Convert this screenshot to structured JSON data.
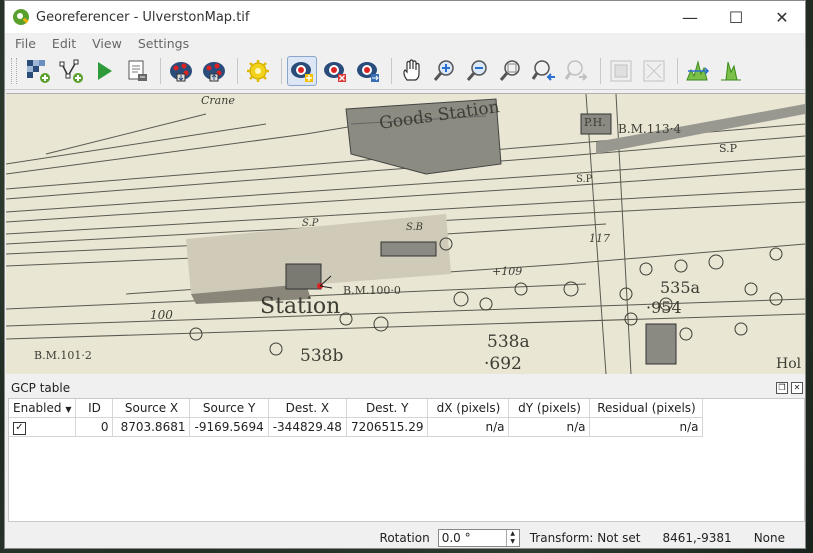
{
  "window": {
    "title": "Georeferencer - UlverstonMap.tif",
    "minimize": "—",
    "maximize": "☐",
    "close": "✕"
  },
  "menu": [
    "File",
    "Edit",
    "View",
    "Settings"
  ],
  "map": {
    "labels": {
      "crane": "Crane",
      "goods_station": "Goods Station",
      "ph": "P.H.",
      "bm113": "B.M.113·4",
      "sp1": "S.P",
      "sp2": "S.P",
      "sp3": "S.P",
      "sb": "S.B",
      "n117": "117",
      "n109": "+109",
      "bm100": "B.M.100·0",
      "station": "Station",
      "n100": "100",
      "n535a": "535a",
      "n954": "·954",
      "bm101": "B.M.101·2",
      "n538b": "538b",
      "n538a": "538a",
      "n692": "·692",
      "hol": "Hol"
    }
  },
  "gcp_panel": {
    "title": "GCP table",
    "columns": [
      "Enabled",
      "ID",
      "Source X",
      "Source Y",
      "Dest. X",
      "Dest. Y",
      "dX (pixels)",
      "dY (pixels)",
      "Residual (pixels)"
    ],
    "rows": [
      {
        "enabled": "✓",
        "id": "0",
        "source_x": "8703.8681",
        "source_y": "-9169.5694",
        "dest_x": "-344829.48",
        "dest_y": "7206515.29",
        "dx": "n/a",
        "dy": "n/a",
        "residual": "n/a"
      }
    ]
  },
  "status": {
    "rotation_label": "Rotation",
    "rotation_value": "0.0 °",
    "transform": "Transform: Not set",
    "coords": "8461,-9381",
    "crs": "None"
  }
}
